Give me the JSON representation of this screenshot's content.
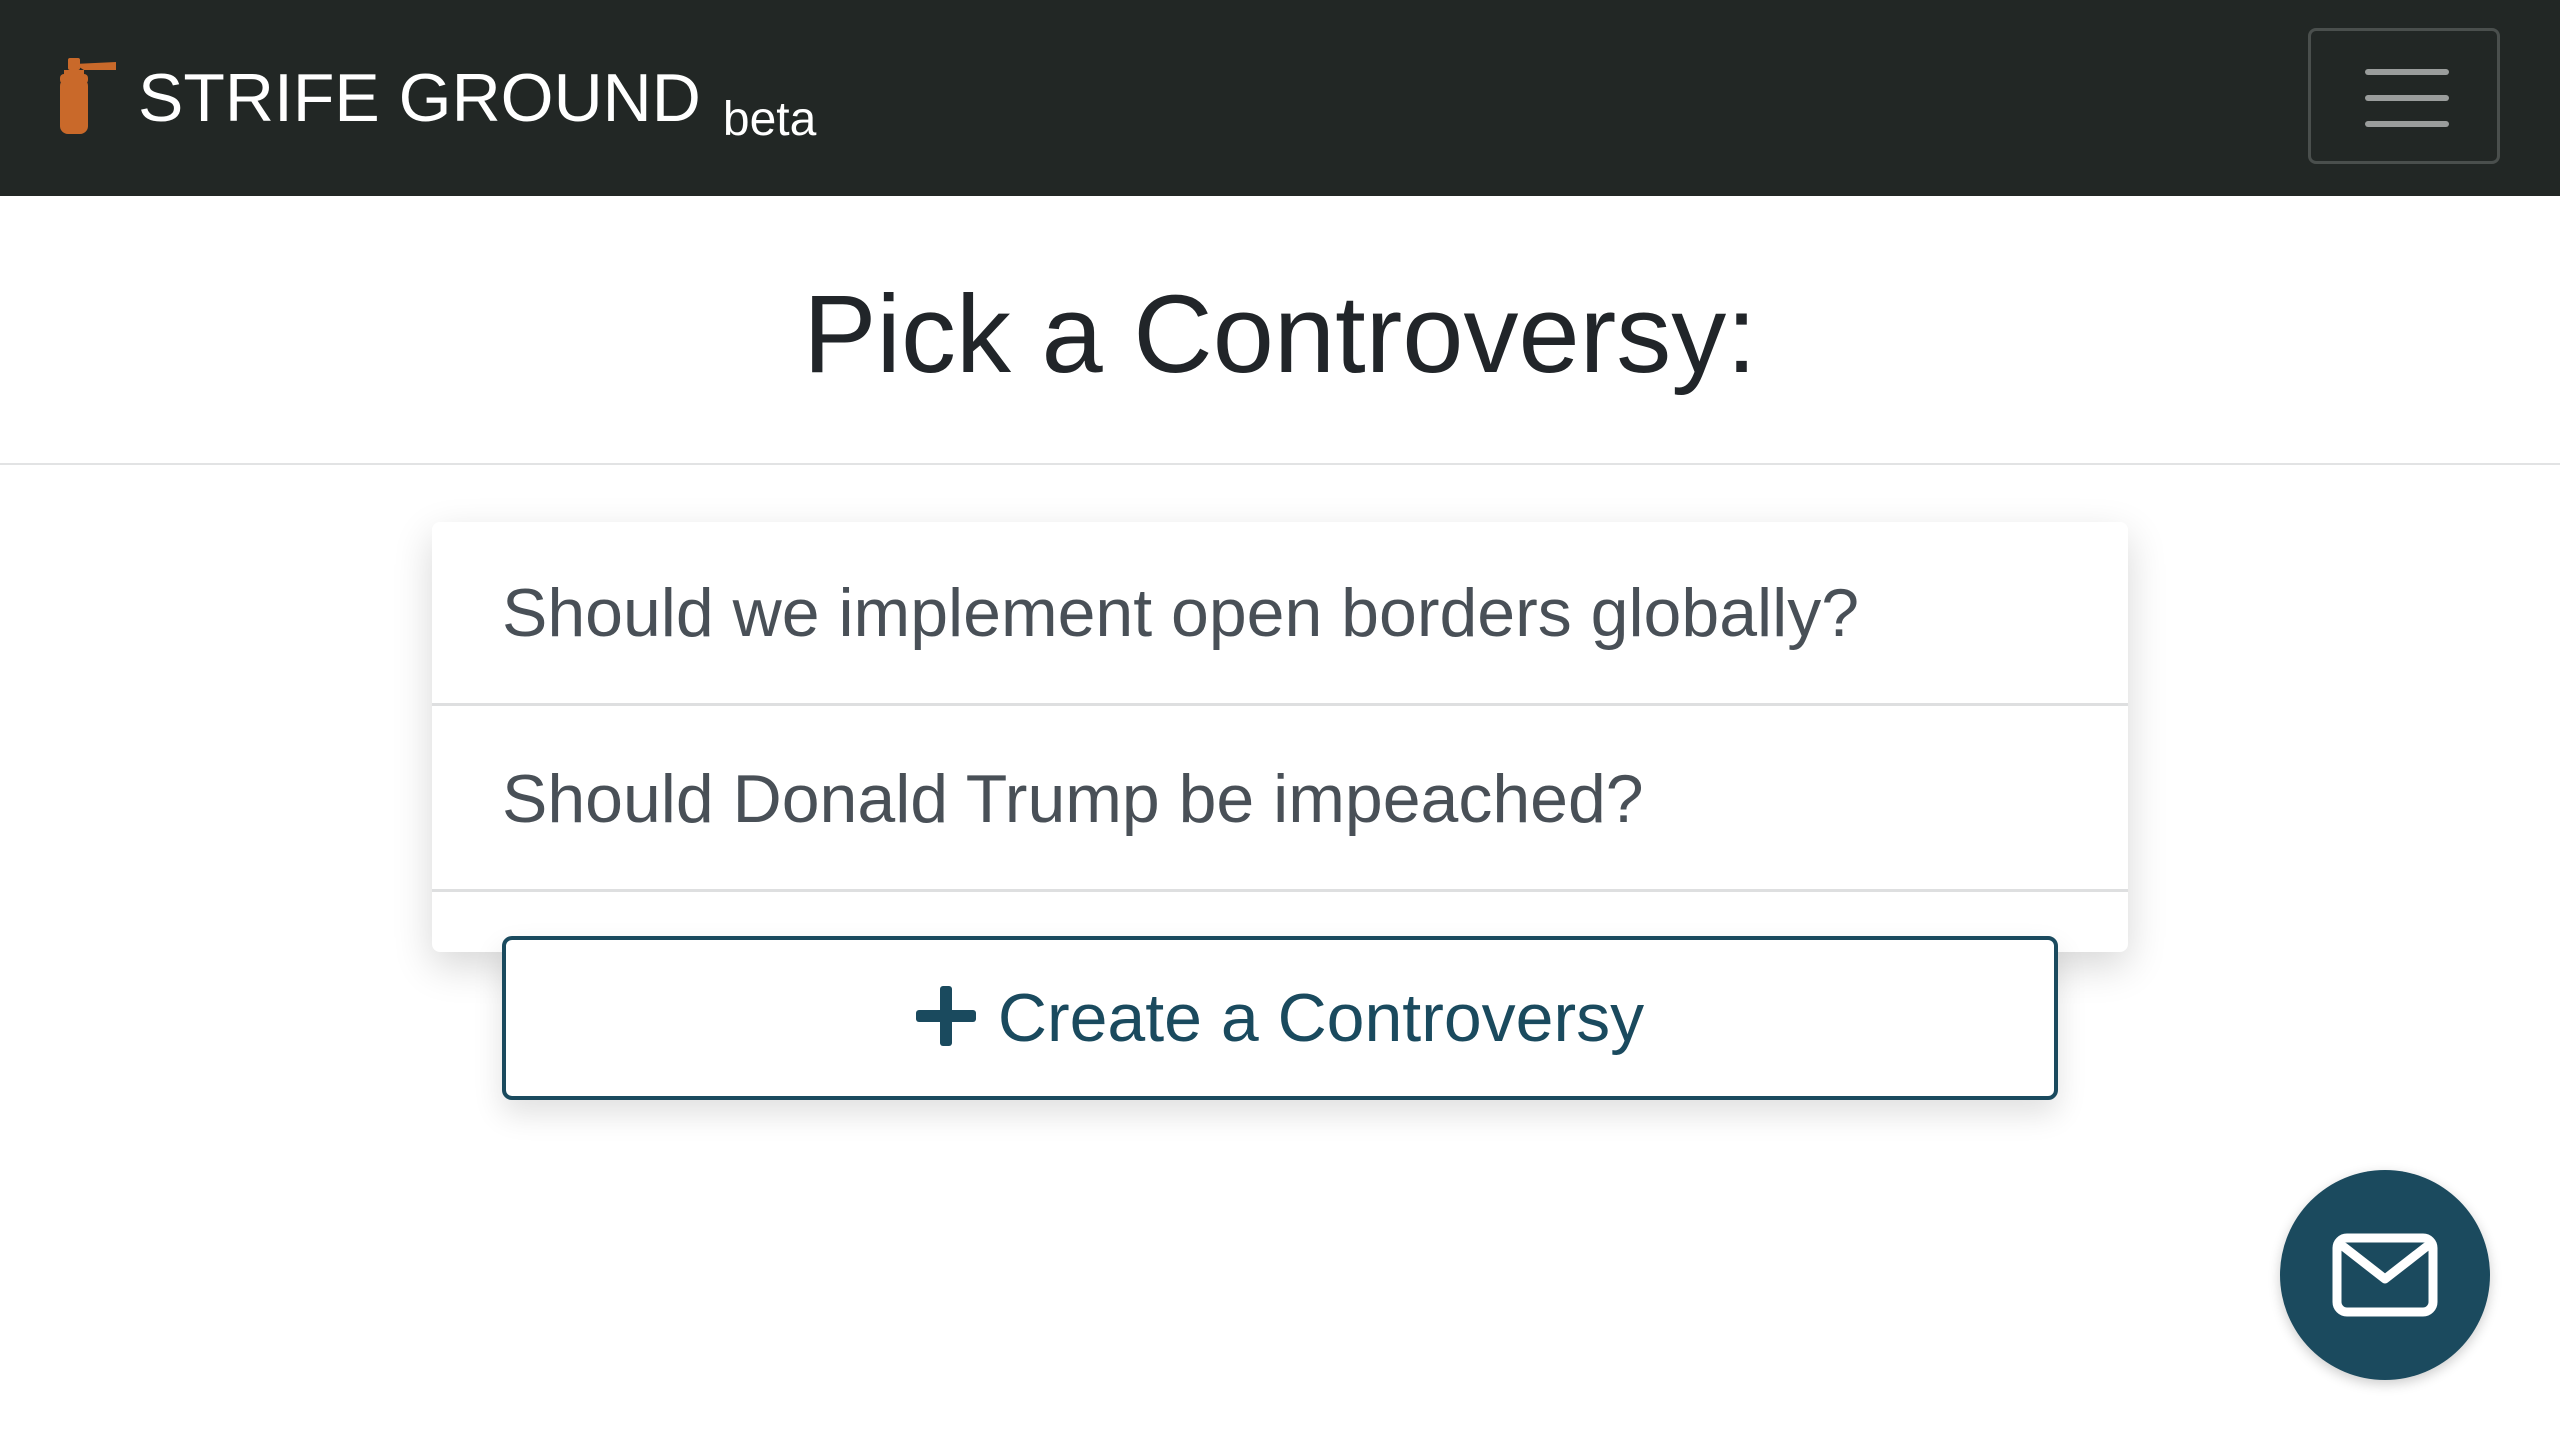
{
  "header": {
    "brand_name": "STRIFE GROUND",
    "brand_badge": "beta",
    "logo_icon": "fire-extinguisher-icon",
    "menu_icon": "hamburger-menu-icon",
    "background_color": "#222725",
    "logo_color": "#c9692a"
  },
  "main": {
    "title": "Pick a Controversy:",
    "controversies": [
      "Should we implement open borders globally?",
      "Should Donald Trump be impeached?"
    ],
    "create_button": {
      "label": "Create a Controversy",
      "icon": "plus-icon"
    },
    "accent_color": "#1b4a5e"
  },
  "fab": {
    "icon": "mail-icon"
  }
}
